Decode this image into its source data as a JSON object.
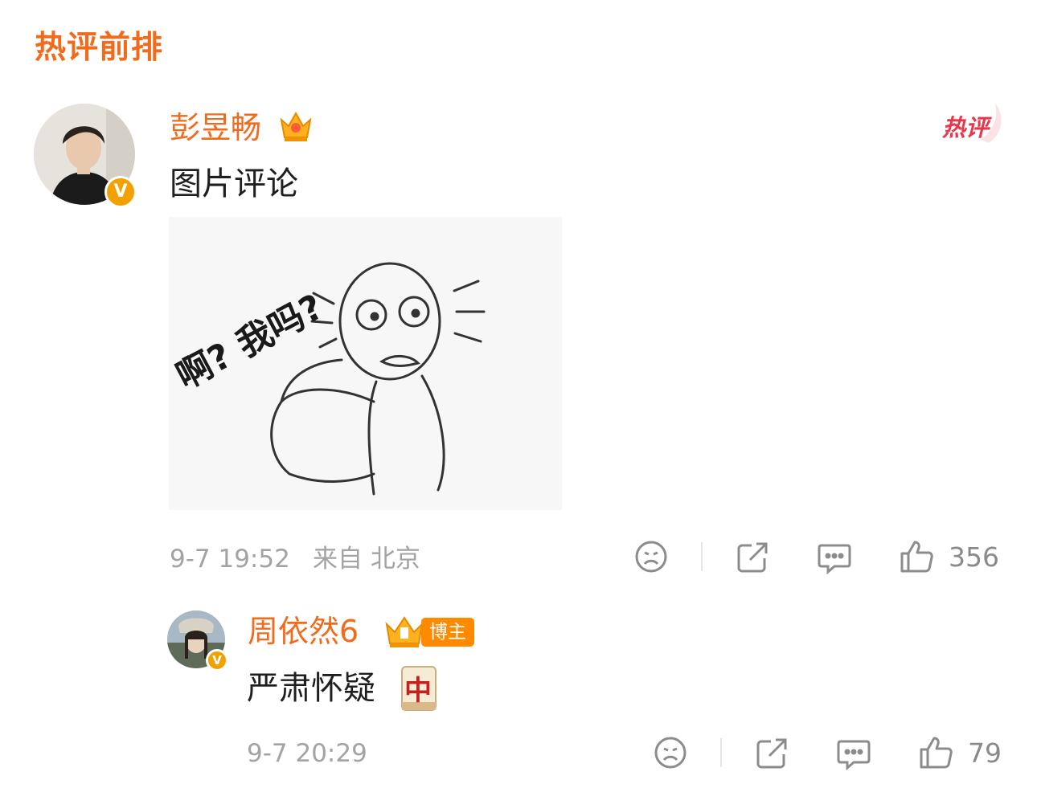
{
  "section": {
    "title": "热评前排"
  },
  "comments": [
    {
      "username": "彭昱畅",
      "text": "图片评论",
      "time": "9-7 19:52",
      "location": "来自 北京",
      "likes": "356",
      "hot_tag": "热评",
      "image_caption": "啊? 我吗?"
    }
  ],
  "reply": {
    "username": "周依然6",
    "badge": "博主",
    "text": "严肃怀疑",
    "emoji": "中",
    "time": "9-7 20:29",
    "likes": "79"
  },
  "icons": [
    "crown-icon",
    "verified-icon",
    "dislike-icon",
    "share-icon",
    "comment-icon",
    "like-icon",
    "mahjong-icon"
  ],
  "colors": {
    "accent": "#f26a1b",
    "hot": "#e8364a",
    "verified": "#f2a100",
    "meta": "#a3a3a3"
  }
}
